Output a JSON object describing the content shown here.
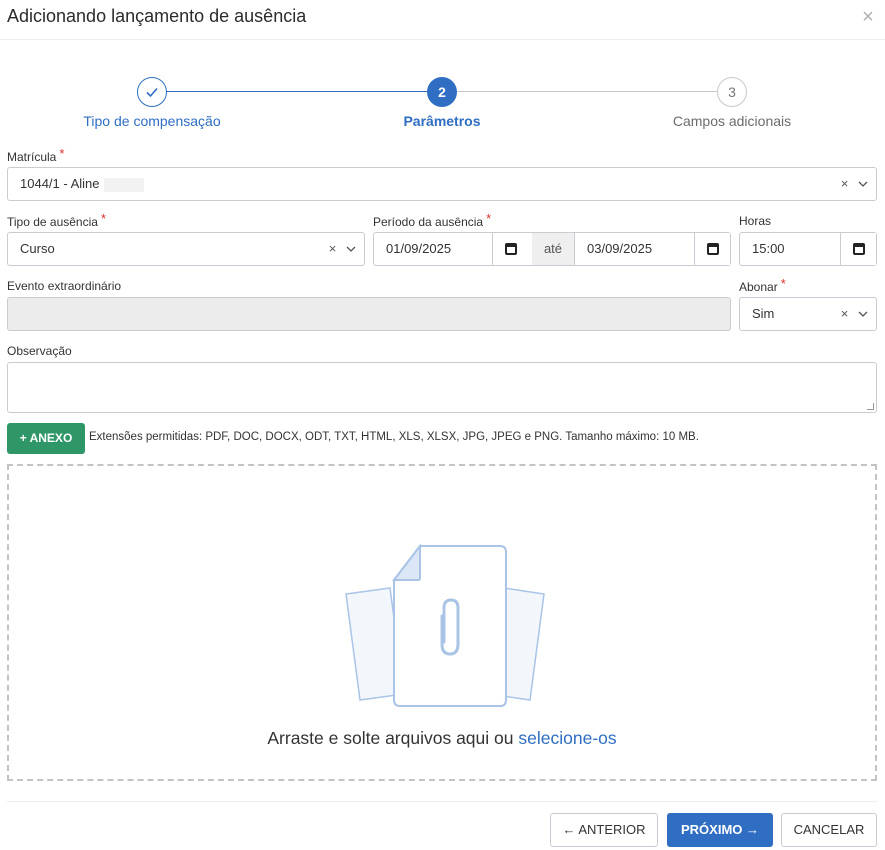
{
  "modal": {
    "title": "Adicionando lançamento de ausência",
    "close_icon": "×"
  },
  "stepper": {
    "steps": [
      {
        "number": "✓",
        "label": "Tipo de compensação",
        "state": "done"
      },
      {
        "number": "2",
        "label": "Parâmetros",
        "state": "active"
      },
      {
        "number": "3",
        "label": "Campos adicionais",
        "state": "pending"
      }
    ]
  },
  "form": {
    "matricula": {
      "label": "Matrícula",
      "required": "*",
      "value": "1044/1 - Aline"
    },
    "tipo_ausencia": {
      "label": "Tipo de ausência",
      "required": "*",
      "value": "Curso"
    },
    "periodo": {
      "label": "Período da ausência",
      "required": "*",
      "start": "01/09/2025",
      "separator": "até",
      "end": "03/09/2025"
    },
    "horas": {
      "label": "Horas",
      "value": "15:00"
    },
    "evento": {
      "label": "Evento extraordinário",
      "value": ""
    },
    "abonar": {
      "label": "Abonar",
      "required": "*",
      "value": "Sim"
    },
    "observacao": {
      "label": "Observação",
      "value": ""
    },
    "clear_icon": "×",
    "dropdown_icon": "⌵"
  },
  "attachments": {
    "button_label": "+ ANEXO",
    "extensions_text": "Extensões permitidas: PDF, DOC, DOCX, ODT, TXT, HTML, XLS, XLSX, JPG, JPEG e PNG. Tamanho máximo: 10 MB.",
    "drop_text": "Arraste e solte arquivos aqui ou",
    "drop_link": "selecione-os"
  },
  "footer": {
    "prev_label": "← ANTERIOR",
    "next_label": "PRÓXIMO →",
    "cancel_label": "CANCELAR"
  },
  "colors": {
    "primary": "#2f6ec2",
    "success": "#2f9767",
    "required": "#e0312f"
  }
}
